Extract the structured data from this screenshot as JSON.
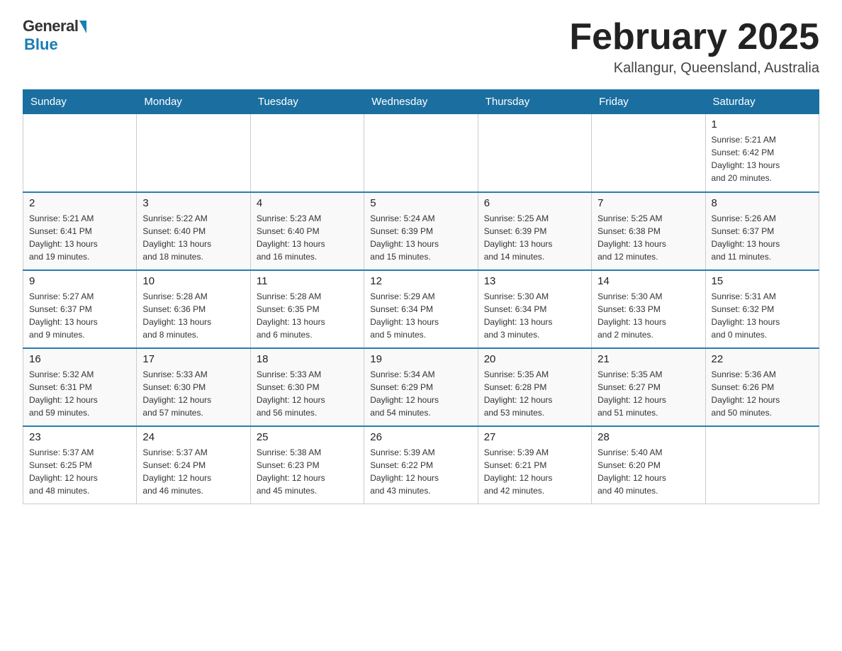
{
  "header": {
    "logo_general": "General",
    "logo_blue": "Blue",
    "month_title": "February 2025",
    "location": "Kallangur, Queensland, Australia"
  },
  "weekdays": [
    "Sunday",
    "Monday",
    "Tuesday",
    "Wednesday",
    "Thursday",
    "Friday",
    "Saturday"
  ],
  "weeks": [
    {
      "days": [
        {
          "num": "",
          "info": ""
        },
        {
          "num": "",
          "info": ""
        },
        {
          "num": "",
          "info": ""
        },
        {
          "num": "",
          "info": ""
        },
        {
          "num": "",
          "info": ""
        },
        {
          "num": "",
          "info": ""
        },
        {
          "num": "1",
          "info": "Sunrise: 5:21 AM\nSunset: 6:42 PM\nDaylight: 13 hours\nand 20 minutes."
        }
      ]
    },
    {
      "days": [
        {
          "num": "2",
          "info": "Sunrise: 5:21 AM\nSunset: 6:41 PM\nDaylight: 13 hours\nand 19 minutes."
        },
        {
          "num": "3",
          "info": "Sunrise: 5:22 AM\nSunset: 6:40 PM\nDaylight: 13 hours\nand 18 minutes."
        },
        {
          "num": "4",
          "info": "Sunrise: 5:23 AM\nSunset: 6:40 PM\nDaylight: 13 hours\nand 16 minutes."
        },
        {
          "num": "5",
          "info": "Sunrise: 5:24 AM\nSunset: 6:39 PM\nDaylight: 13 hours\nand 15 minutes."
        },
        {
          "num": "6",
          "info": "Sunrise: 5:25 AM\nSunset: 6:39 PM\nDaylight: 13 hours\nand 14 minutes."
        },
        {
          "num": "7",
          "info": "Sunrise: 5:25 AM\nSunset: 6:38 PM\nDaylight: 13 hours\nand 12 minutes."
        },
        {
          "num": "8",
          "info": "Sunrise: 5:26 AM\nSunset: 6:37 PM\nDaylight: 13 hours\nand 11 minutes."
        }
      ]
    },
    {
      "days": [
        {
          "num": "9",
          "info": "Sunrise: 5:27 AM\nSunset: 6:37 PM\nDaylight: 13 hours\nand 9 minutes."
        },
        {
          "num": "10",
          "info": "Sunrise: 5:28 AM\nSunset: 6:36 PM\nDaylight: 13 hours\nand 8 minutes."
        },
        {
          "num": "11",
          "info": "Sunrise: 5:28 AM\nSunset: 6:35 PM\nDaylight: 13 hours\nand 6 minutes."
        },
        {
          "num": "12",
          "info": "Sunrise: 5:29 AM\nSunset: 6:34 PM\nDaylight: 13 hours\nand 5 minutes."
        },
        {
          "num": "13",
          "info": "Sunrise: 5:30 AM\nSunset: 6:34 PM\nDaylight: 13 hours\nand 3 minutes."
        },
        {
          "num": "14",
          "info": "Sunrise: 5:30 AM\nSunset: 6:33 PM\nDaylight: 13 hours\nand 2 minutes."
        },
        {
          "num": "15",
          "info": "Sunrise: 5:31 AM\nSunset: 6:32 PM\nDaylight: 13 hours\nand 0 minutes."
        }
      ]
    },
    {
      "days": [
        {
          "num": "16",
          "info": "Sunrise: 5:32 AM\nSunset: 6:31 PM\nDaylight: 12 hours\nand 59 minutes."
        },
        {
          "num": "17",
          "info": "Sunrise: 5:33 AM\nSunset: 6:30 PM\nDaylight: 12 hours\nand 57 minutes."
        },
        {
          "num": "18",
          "info": "Sunrise: 5:33 AM\nSunset: 6:30 PM\nDaylight: 12 hours\nand 56 minutes."
        },
        {
          "num": "19",
          "info": "Sunrise: 5:34 AM\nSunset: 6:29 PM\nDaylight: 12 hours\nand 54 minutes."
        },
        {
          "num": "20",
          "info": "Sunrise: 5:35 AM\nSunset: 6:28 PM\nDaylight: 12 hours\nand 53 minutes."
        },
        {
          "num": "21",
          "info": "Sunrise: 5:35 AM\nSunset: 6:27 PM\nDaylight: 12 hours\nand 51 minutes."
        },
        {
          "num": "22",
          "info": "Sunrise: 5:36 AM\nSunset: 6:26 PM\nDaylight: 12 hours\nand 50 minutes."
        }
      ]
    },
    {
      "days": [
        {
          "num": "23",
          "info": "Sunrise: 5:37 AM\nSunset: 6:25 PM\nDaylight: 12 hours\nand 48 minutes."
        },
        {
          "num": "24",
          "info": "Sunrise: 5:37 AM\nSunset: 6:24 PM\nDaylight: 12 hours\nand 46 minutes."
        },
        {
          "num": "25",
          "info": "Sunrise: 5:38 AM\nSunset: 6:23 PM\nDaylight: 12 hours\nand 45 minutes."
        },
        {
          "num": "26",
          "info": "Sunrise: 5:39 AM\nSunset: 6:22 PM\nDaylight: 12 hours\nand 43 minutes."
        },
        {
          "num": "27",
          "info": "Sunrise: 5:39 AM\nSunset: 6:21 PM\nDaylight: 12 hours\nand 42 minutes."
        },
        {
          "num": "28",
          "info": "Sunrise: 5:40 AM\nSunset: 6:20 PM\nDaylight: 12 hours\nand 40 minutes."
        },
        {
          "num": "",
          "info": ""
        }
      ]
    }
  ]
}
